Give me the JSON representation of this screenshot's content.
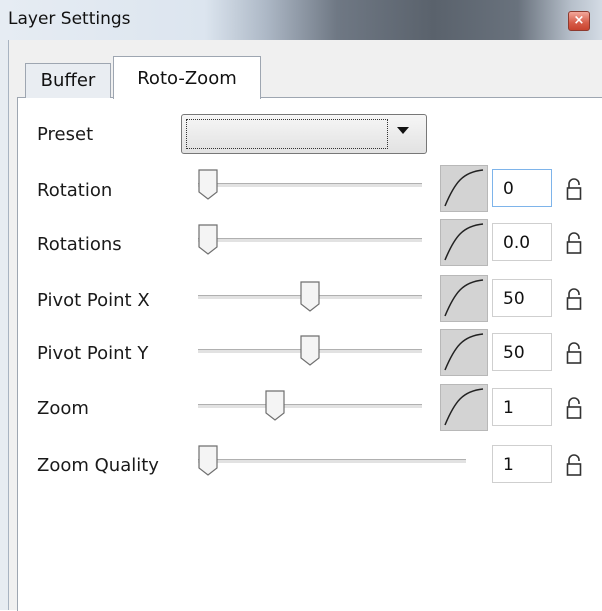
{
  "window": {
    "title": "Layer Settings",
    "close_glyph": "×"
  },
  "tabs": [
    {
      "label": "Buffer",
      "selected": false
    },
    {
      "label": "Roto-Zoom",
      "selected": true
    }
  ],
  "preset": {
    "label": "Preset",
    "value": ""
  },
  "rows": [
    {
      "label": "Rotation",
      "slider_position": 0.0,
      "value": "0",
      "has_curve": true
    },
    {
      "label": "Rotations",
      "slider_position": 0.0,
      "value": "0.0",
      "has_curve": true
    },
    {
      "label": "Pivot Point X",
      "slider_position": 0.5,
      "value": "50",
      "has_curve": true
    },
    {
      "label": "Pivot Point Y",
      "slider_position": 0.5,
      "value": "50",
      "has_curve": true
    },
    {
      "label": "Zoom",
      "slider_position": 0.33,
      "value": "1",
      "has_curve": true
    },
    {
      "label": "Zoom Quality",
      "slider_position": 0.0,
      "value": "1",
      "has_curve": false
    }
  ],
  "icons": {
    "curve": "value-curve-icon",
    "lock": "lock-icon",
    "dropdown": "chevron-down-icon"
  },
  "colors": {
    "focus_border": "#7eb4ea",
    "close_button": "#d65c48"
  }
}
